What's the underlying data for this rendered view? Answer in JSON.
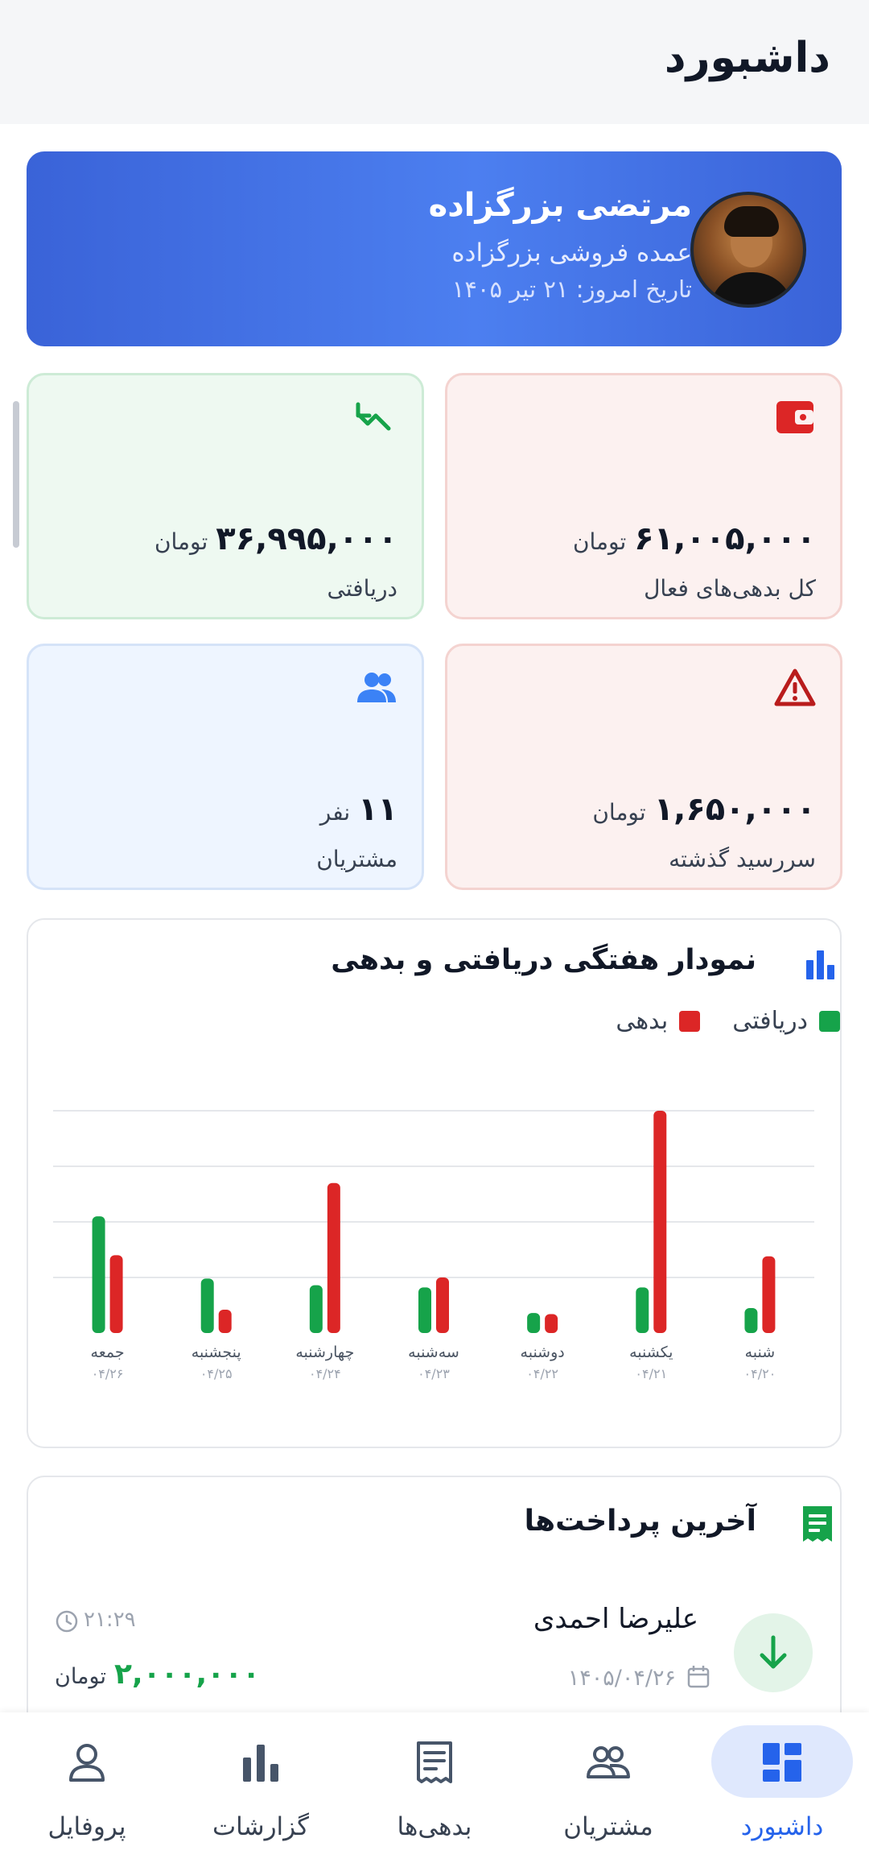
{
  "header": {
    "title": "داشبورد"
  },
  "profile": {
    "name": "مرتضی بزرگزاده",
    "shop": "عمده فروشی بزرگزاده",
    "date": "تاریخ امروز: ۲۱ تیر ۱۴۰۵"
  },
  "stats": {
    "debt": {
      "value": "۶۱,۰۰۵,۰۰۰",
      "unit": "تومان",
      "label": "کل بدهی‌های فعال",
      "icon": "wallet-icon",
      "color": "#dc2626"
    },
    "received": {
      "value": "۳۶,۹۹۵,۰۰۰",
      "unit": "تومان",
      "label": "دریافتی",
      "icon": "trending-up-icon",
      "color": "#16a34a"
    },
    "overdue": {
      "value": "۱,۶۵۰,۰۰۰",
      "unit": "تومان",
      "label": "سررسید گذشته",
      "icon": "warning-icon",
      "color": "#b91c1c"
    },
    "customers": {
      "value": "۱۱",
      "unit": "نفر",
      "label": "مشتریان",
      "icon": "users-icon",
      "color": "#3b82f6"
    }
  },
  "chart_section": {
    "title": "نمودار هفتگی دریافتی و بدهی",
    "icon": "bar-chart-icon"
  },
  "chart_data": {
    "type": "bar",
    "title": "نمودار هفتگی دریافتی و بدهی",
    "categories": [
      "شنبه",
      "یکشنبه",
      "دوشنبه",
      "سه‌شنبه",
      "چهارشنبه",
      "پنجشنبه",
      "جمعه"
    ],
    "dates": [
      "۰۴/۲۰",
      "۰۴/۲۱",
      "۰۴/۲۲",
      "۰۴/۲۳",
      "۰۴/۲۴",
      "۰۴/۲۵",
      "۰۴/۲۶"
    ],
    "series": [
      {
        "name": "دریافتی",
        "color": "#16a34a",
        "values": [
          0.45,
          0.82,
          0.36,
          0.82,
          0.86,
          0.98,
          2.1
        ]
      },
      {
        "name": "بدهی",
        "color": "#dc2626",
        "values": [
          1.38,
          4.0,
          0.34,
          1.0,
          2.7,
          0.42,
          1.4
        ]
      }
    ],
    "ylim": [
      0,
      4
    ],
    "grid": true,
    "legend": "top-right"
  },
  "payments": {
    "title": "آخرین پرداخت‌ها",
    "icon": "receipt-icon",
    "items": [
      {
        "name": "علیرضا احمدی",
        "date": "۱۴۰۵/۰۴/۲۶",
        "time": "۲۱:۲۹",
        "amount": "۲,۰۰۰,۰۰۰",
        "unit": "تومان",
        "icon": "arrow-down-icon"
      }
    ]
  },
  "nav": [
    {
      "label": "داشبورد",
      "icon": "dashboard-icon",
      "active": true
    },
    {
      "label": "مشتریان",
      "icon": "users-icon",
      "active": false
    },
    {
      "label": "بدهی‌ها",
      "icon": "receipt-icon",
      "active": false
    },
    {
      "label": "گزارشات",
      "icon": "bar-chart-icon",
      "active": false
    },
    {
      "label": "پروفایل",
      "icon": "person-icon",
      "active": false
    }
  ]
}
